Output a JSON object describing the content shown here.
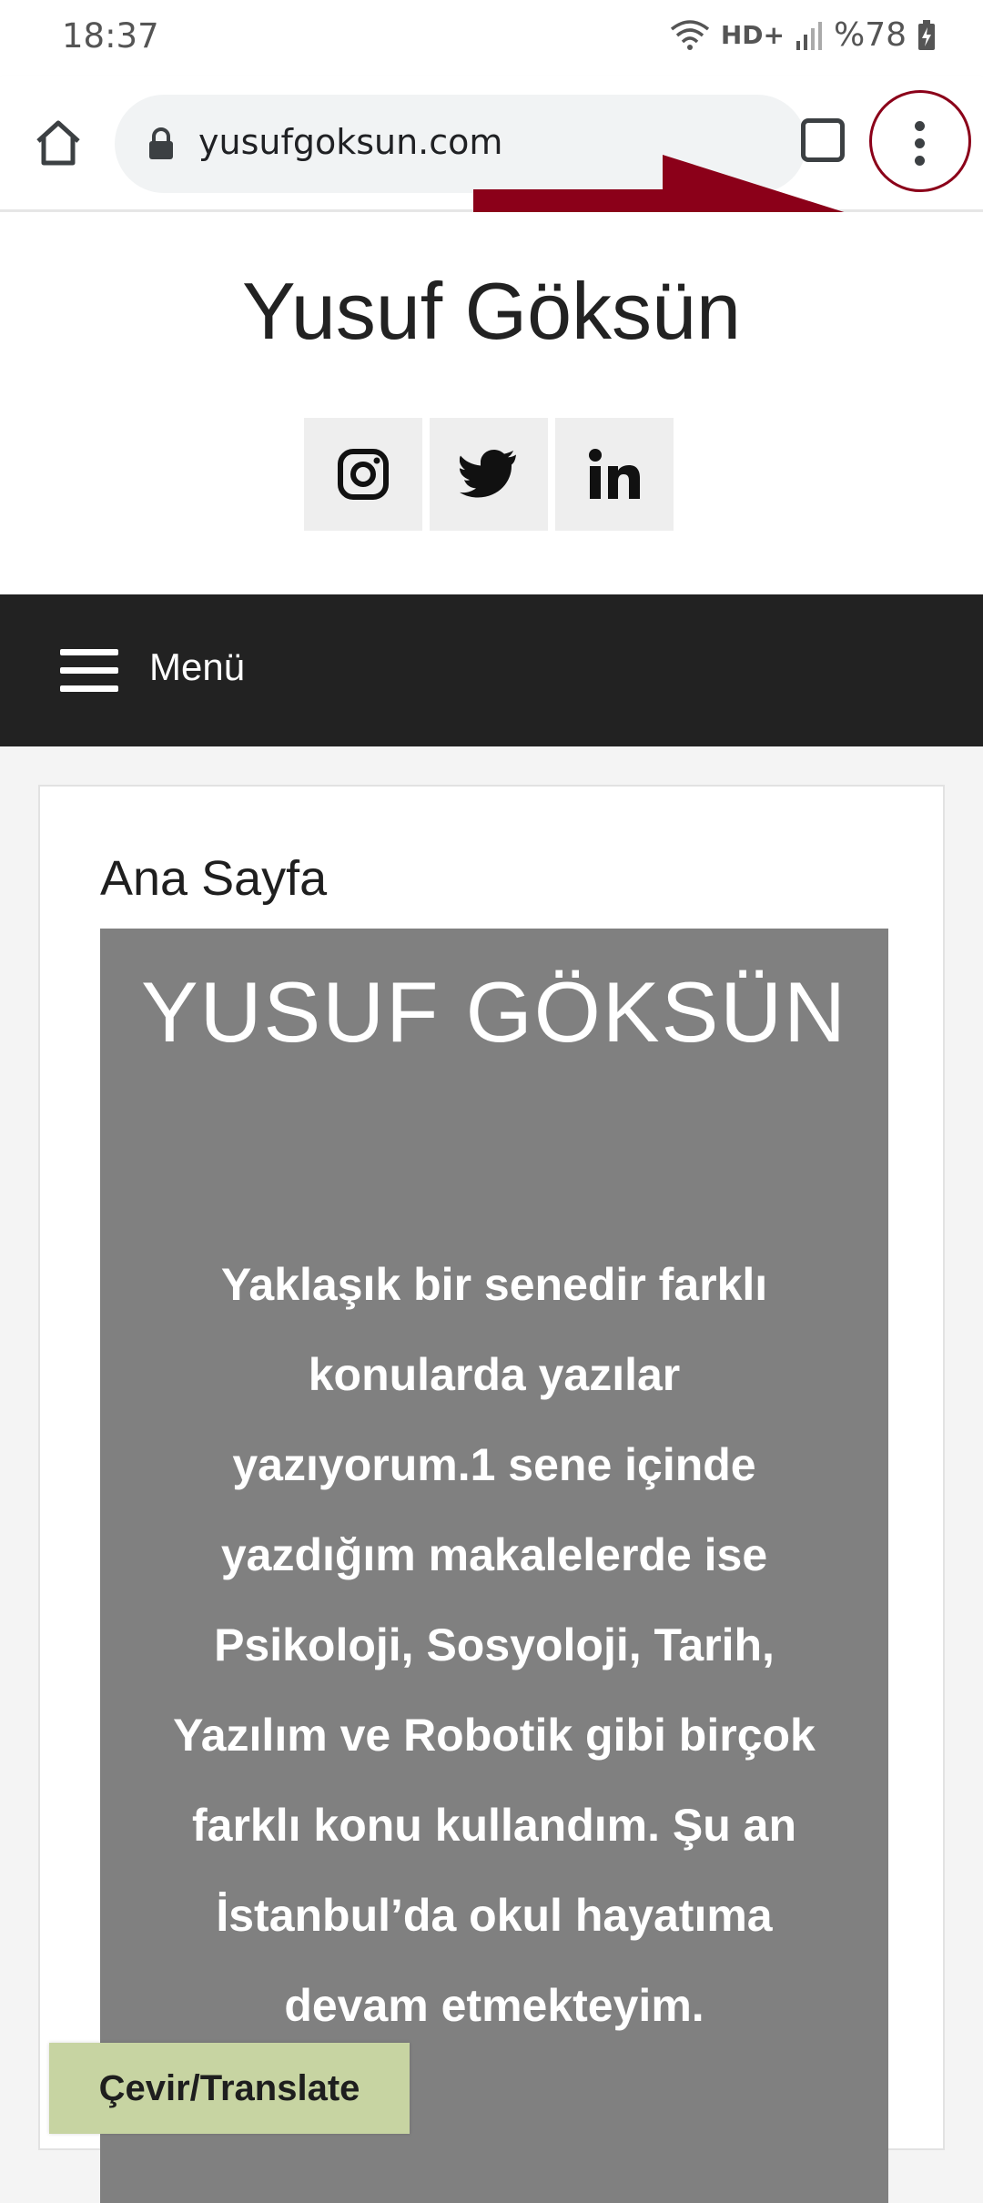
{
  "status_bar": {
    "time": "18:37",
    "network": "HD+",
    "battery": "%78",
    "icons": [
      "wifi-icon",
      "signal-icon",
      "battery-charging-icon"
    ]
  },
  "browser": {
    "url": "yusufgoksun.com",
    "icons": [
      "home-icon",
      "lock-icon",
      "tab-switcher-icon",
      "more-vert-icon"
    ],
    "annotation_color": "#8b0019"
  },
  "site": {
    "title": "Yusuf Göksün",
    "social": [
      "instagram-icon",
      "twitter-icon",
      "linkedin-icon"
    ]
  },
  "nav": {
    "label": "Menü"
  },
  "page": {
    "heading": "Ana Sayfa",
    "hero_title": "YUSUF GÖKSÜN",
    "hero_text": "Yaklaşık bir senedir farklı konularda yazılar yazıyorum.1 sene içinde yazdığım makalelerde ise Psikoloji, Sosyoloji, Tarih, Yazılım ve Robotik gibi birçok farklı konu kullandım. Şu an İstanbul’da okul hayatıma devam etmekteyim."
  },
  "translate": {
    "label": "Çevir/Translate",
    "color": "#c7d4a2"
  }
}
